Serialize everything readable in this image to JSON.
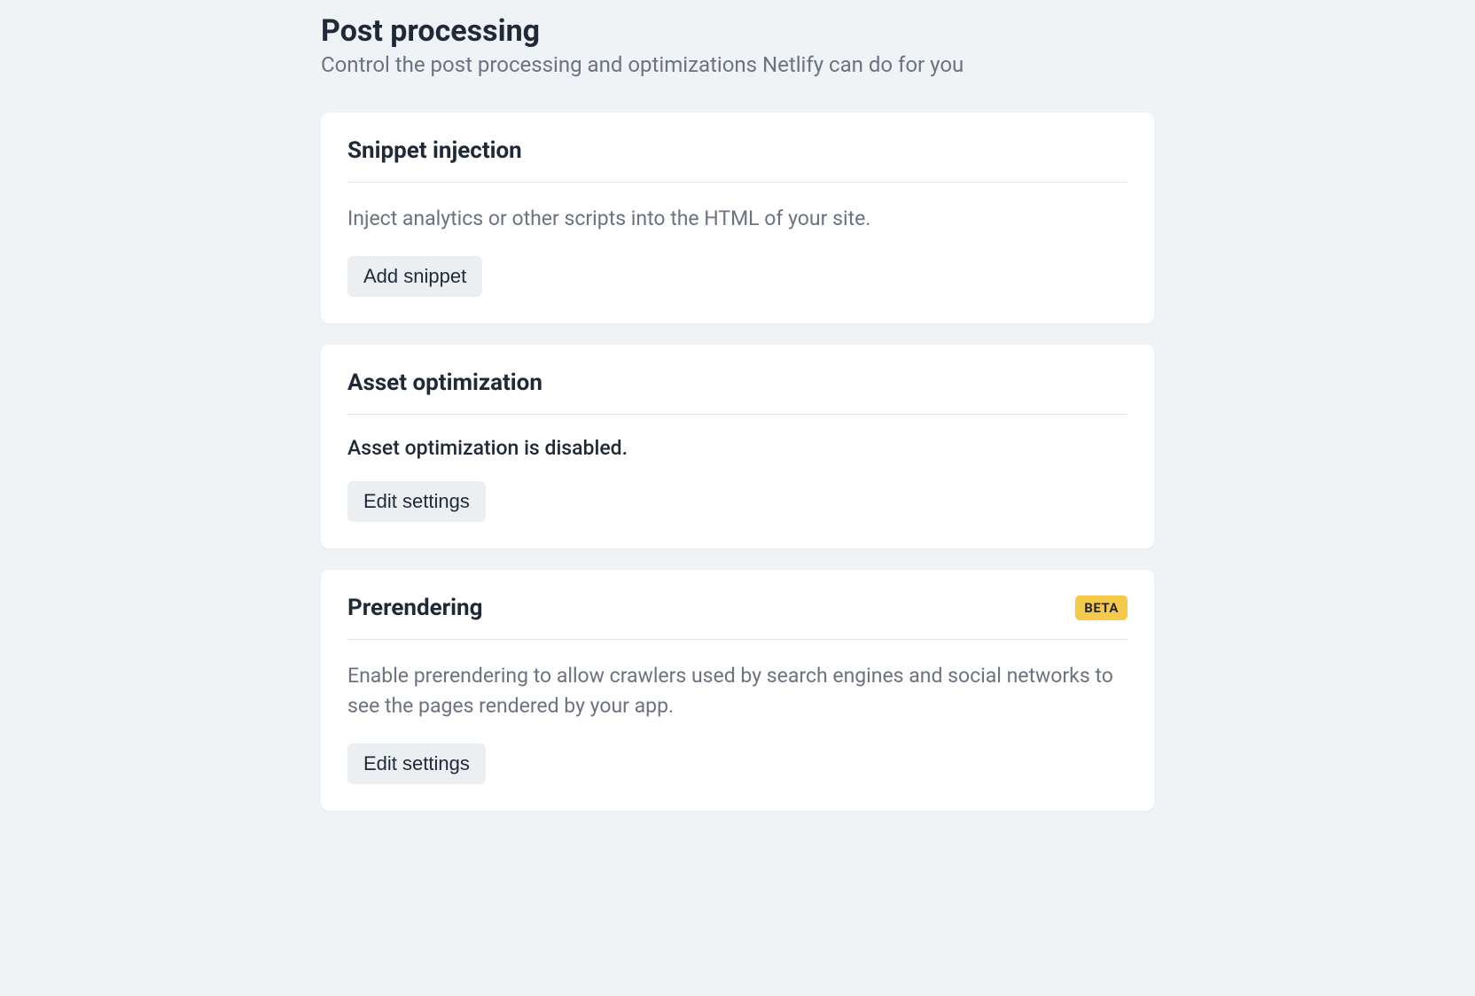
{
  "page": {
    "title": "Post processing",
    "subtitle": "Control the post processing and optimizations Netlify can do for you"
  },
  "cards": {
    "snippet": {
      "title": "Snippet injection",
      "description": "Inject analytics or other scripts into the HTML of your site.",
      "button": "Add snippet"
    },
    "asset": {
      "title": "Asset optimization",
      "status": "Asset optimization is disabled.",
      "button": "Edit settings"
    },
    "prerendering": {
      "title": "Prerendering",
      "badge": "BETA",
      "description": "Enable prerendering to allow crawlers used by search engines and social networks to see the pages rendered by your app.",
      "button": "Edit settings"
    }
  }
}
